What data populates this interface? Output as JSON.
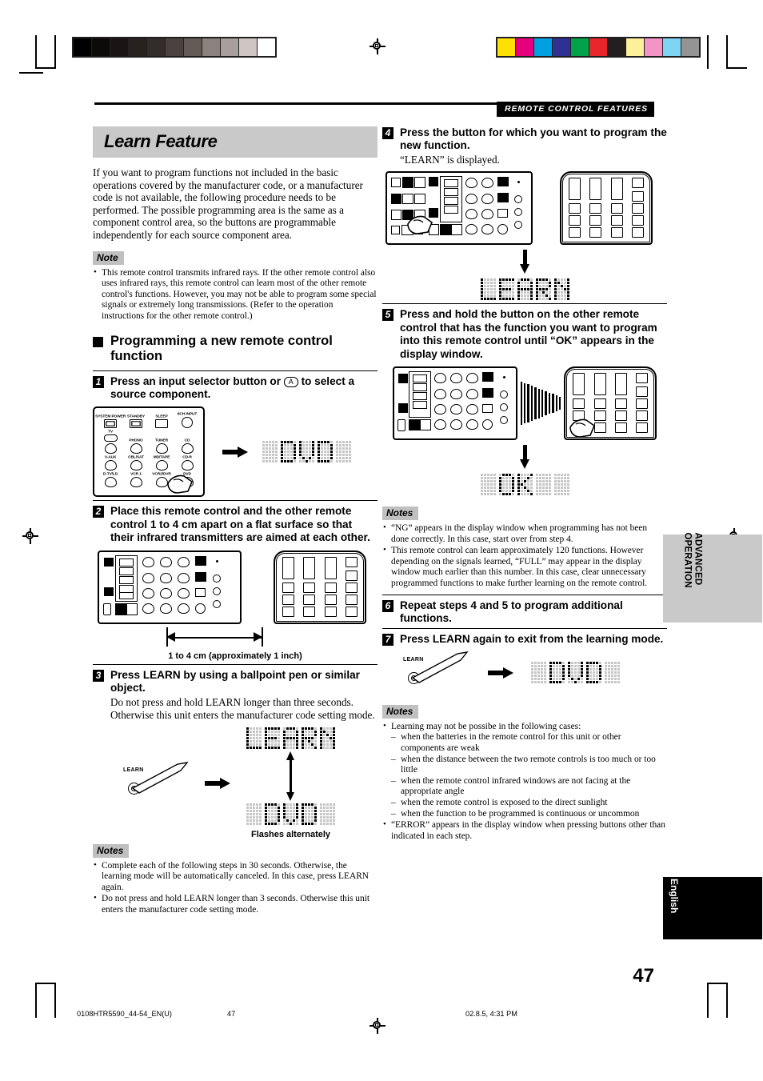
{
  "header": {
    "running_head": "REMOTE CONTROL FEATURES"
  },
  "section": {
    "title": "Learn Feature",
    "intro": "If you want to program functions not included in the basic operations covered by the manufacturer code, or a manufacturer code is not available, the following procedure needs to be performed. The possible programming area is the same as a component control area, so the buttons are programmable independently for each source component area."
  },
  "note_top": {
    "label": "Note",
    "items": [
      "This remote control transmits infrared rays. If the other remote control also uses infrared rays, this remote control can learn most of the other remote control's functions. However, you may not be able to program some special signals or extremely long transmissions. (Refer to the operation instructions for the other remote control.)"
    ]
  },
  "subsection": {
    "heading": "Programming a new remote control function"
  },
  "steps": [
    {
      "num": "1",
      "title_a": "Press an input selector button or",
      "inline_key": "A",
      "title_b": "to select a source component.",
      "display": "DVD"
    },
    {
      "num": "2",
      "title": "Place this remote control and the other remote control 1 to 4 cm apart on a flat surface so that their infrared transmitters are aimed at each other.",
      "caption": "1 to 4 cm (approximately 1 inch)"
    },
    {
      "num": "3",
      "title": "Press LEARN by using a ballpoint pen or similar object.",
      "body": "Do not press and hold LEARN longer than three seconds. Otherwise this unit enters the manufacturer code setting mode.",
      "button_label": "LEARN",
      "display_top": "LEARN",
      "display_bottom": "DVD",
      "caption": "Flashes alternately"
    },
    {
      "num": "4",
      "title": "Press the button for which you want to program the new function.",
      "body": "“LEARN” is displayed.",
      "display": "LEARN"
    },
    {
      "num": "5",
      "title": "Press and hold the button on the other remote control that has the function you want to program into this remote control until “OK” appears in the display window.",
      "display": "OK"
    },
    {
      "num": "6",
      "title": "Repeat steps 4 and 5 to program additional functions."
    },
    {
      "num": "7",
      "title": "Press LEARN again to exit from the learning mode.",
      "button_label": "LEARN",
      "display": "DVD"
    }
  ],
  "notes_left": {
    "label": "Notes",
    "items": [
      "Complete each of the following steps in 30 seconds. Otherwise, the learning mode will be automatically canceled. In this case, press LEARN again.",
      "Do not press and hold LEARN longer than 3 seconds. Otherwise this unit enters the manufacturer code setting mode."
    ]
  },
  "notes_mid": {
    "label": "Notes",
    "items": [
      "“NG” appears in the display window when programming has not been done correctly. In this case, start over from step 4.",
      "This remote control can learn approximately 120 functions. However depending on the signals learned, “FULL” may appear in the display window much earlier than this number. In this case, clear unnecessary programmed functions to make further learning on the remote control."
    ]
  },
  "notes_bottom": {
    "label": "Notes",
    "lead": "Learning may not be possibe in the following cases:",
    "sub_items": [
      "when the batteries in the remote control for this unit or other components are weak",
      "when the distance between the two remote controls is too much or too little",
      "when the remote control infrared windows are not facing at the appropriate angle",
      "when the remote control is exposed to the direct sunlight",
      "when the function to be programmed is continuous or uncommon"
    ],
    "tail": "“ERROR” appears in the display window when pressing buttons other than indicated in each step."
  },
  "remote_buttons": {
    "rows": [
      [
        "SYSTEM POWER",
        "STANDBY",
        "SLEEP",
        "6CH INPUT"
      ],
      [
        "TV",
        "PHONO",
        "TUNER",
        "CD"
      ],
      [
        "V-AUX",
        "CBL/SAT",
        "MD/TAPE",
        "CD-R"
      ],
      [
        "D-TV/LD",
        "VCR 1",
        "VCR2/DVR",
        "DVD"
      ]
    ]
  },
  "side_tabs": {
    "advanced": "ADVANCED OPERATION",
    "language": "English"
  },
  "page_number": "47",
  "footer": {
    "file": "0108HTR5590_44-54_EN(U)",
    "page": "47",
    "timestamp": "02.8.5, 4:31 PM"
  },
  "calibration": {
    "grayscale": [
      "#000000",
      "#0d0a0a",
      "#1a1514",
      "#272120",
      "#332c2a",
      "#4a423f",
      "#645a56",
      "#8b817d",
      "#a89e9b",
      "#cfc6c4",
      "#ffffff"
    ],
    "colors": [
      "#ffe000",
      "#e6007e",
      "#00a0e3",
      "#2e3192",
      "#00a34a",
      "#e8252a",
      "#231f20",
      "#fdf09a",
      "#f494c4",
      "#7fd4f4",
      "#949494"
    ]
  }
}
